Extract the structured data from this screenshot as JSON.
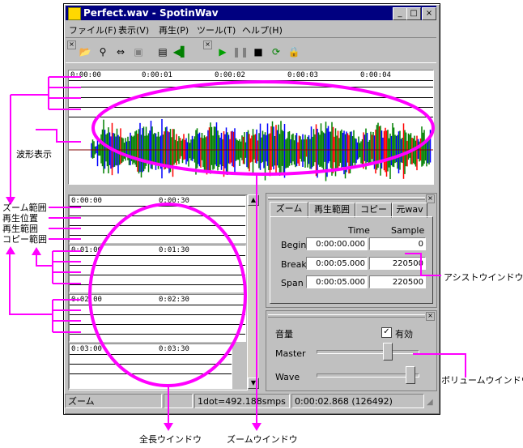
{
  "window": {
    "title": "Perfect.wav - SpotinWav",
    "minimize_label": "_",
    "maximize_label": "□",
    "close_label": "×"
  },
  "menu": {
    "items": [
      "ファイル(F)",
      "表示(V)",
      "再生(P)",
      "ツール(T)",
      "ヘルプ(H)"
    ]
  },
  "toolbar": {
    "icons": [
      "open-icon",
      "find-icon",
      "fit-icon",
      "save-icon",
      "properties-icon",
      "speaker-icon",
      "play-icon",
      "pause-icon",
      "stop-icon",
      "loop-icon",
      "lock-icon"
    ],
    "play_color": "#00a000"
  },
  "zoom_window": {
    "ruler_ticks": [
      "0:00:00",
      "0:00:01",
      "0:00:02",
      "0:00:03",
      "0:00:04"
    ],
    "waveform_colors": [
      "#008000",
      "#0000ff",
      "#ff0000"
    ]
  },
  "overview_window": {
    "rows": [
      {
        "start": "0:00:00",
        "mid": "0:00:30"
      },
      {
        "start": "0:01:00",
        "mid": "0:01:30"
      },
      {
        "start": "0:02:00",
        "mid": "0:02:30"
      },
      {
        "start": "0:03:00",
        "mid": "0:03:30"
      }
    ]
  },
  "assist": {
    "tabs": [
      "ズーム",
      "再生範囲",
      "コピー",
      "元wav"
    ],
    "col_time": "Time",
    "col_sample": "Sample",
    "rows": [
      {
        "label": "Begin",
        "time": "0:00:00.000",
        "sample": "0"
      },
      {
        "label": "Break",
        "time": "0:00:05.000",
        "sample": "220500"
      },
      {
        "label": "Span",
        "time": "0:00:05.000",
        "sample": "220500"
      }
    ]
  },
  "volume": {
    "title": "音量",
    "enable_label": "有効",
    "enabled": true,
    "master_label": "Master",
    "wave_label": "Wave",
    "master_level": 0.73,
    "wave_level": 0.97
  },
  "status": {
    "mode": "ズーム",
    "resolution": "1dot=492.188smps",
    "position": "0:00:02.868 (126492)"
  },
  "annotations": {
    "waveform": "波形表示",
    "zoom_range": "ズーム範囲",
    "play_position": "再生位置",
    "play_range": "再生範囲",
    "copy_range": "コピー範囲",
    "assist_window": "アシストウインドウ",
    "volume_window": "ボリュームウインドウ",
    "full_window": "全長ウインドウ",
    "zoom_window": "ズームウインドウ",
    "color": "#ff00ff"
  }
}
